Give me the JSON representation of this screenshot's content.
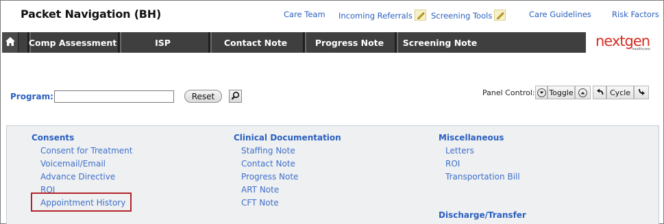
{
  "header": {
    "title": "Packet Navigation (BH)",
    "links": [
      {
        "label": "Care Team"
      },
      {
        "label": "Incoming Referrals",
        "icon": "edit-pencil-icon"
      },
      {
        "label": "Screening Tools",
        "icon": "edit-pencil-icon"
      },
      {
        "label": "Care Guidelines"
      },
      {
        "label": "Risk Factors"
      }
    ]
  },
  "navbar": {
    "home_icon": "home-icon",
    "tabs": [
      {
        "label": "Comp Assessment"
      },
      {
        "label": "ISP"
      },
      {
        "label": "Contact Note"
      },
      {
        "label": "Progress Note"
      },
      {
        "label": "Screening Note"
      }
    ]
  },
  "logo": {
    "text": "nextgen",
    "sub": "healthcare"
  },
  "program": {
    "label": "Program:",
    "value": "",
    "reset_label": "Reset",
    "search_icon": "magnifier-icon"
  },
  "panel_control": {
    "label": "Panel Control:",
    "toggle_label": "Toggle",
    "cycle_label": "Cycle"
  },
  "sections": {
    "consents": {
      "title": "Consents",
      "items": [
        "Consent for Treatment",
        "Voicemail/Email",
        "Advance Directive",
        "ROI",
        "Appointment History"
      ]
    },
    "clinical": {
      "title": "Clinical Documentation",
      "items": [
        "Staffing Note",
        "Contact Note",
        "Progress Note",
        "ART Note",
        "CFT Note"
      ]
    },
    "misc": {
      "title": "Miscellaneous",
      "items": [
        "Letters",
        "ROI",
        "Transportation Bill"
      ]
    },
    "discharge": {
      "title": "Discharge/Transfer"
    }
  },
  "colors": {
    "link": "#2a5fbf",
    "navbar": "#3f3f3f",
    "highlight": "#b3232a",
    "brand": "#d62b1f"
  }
}
